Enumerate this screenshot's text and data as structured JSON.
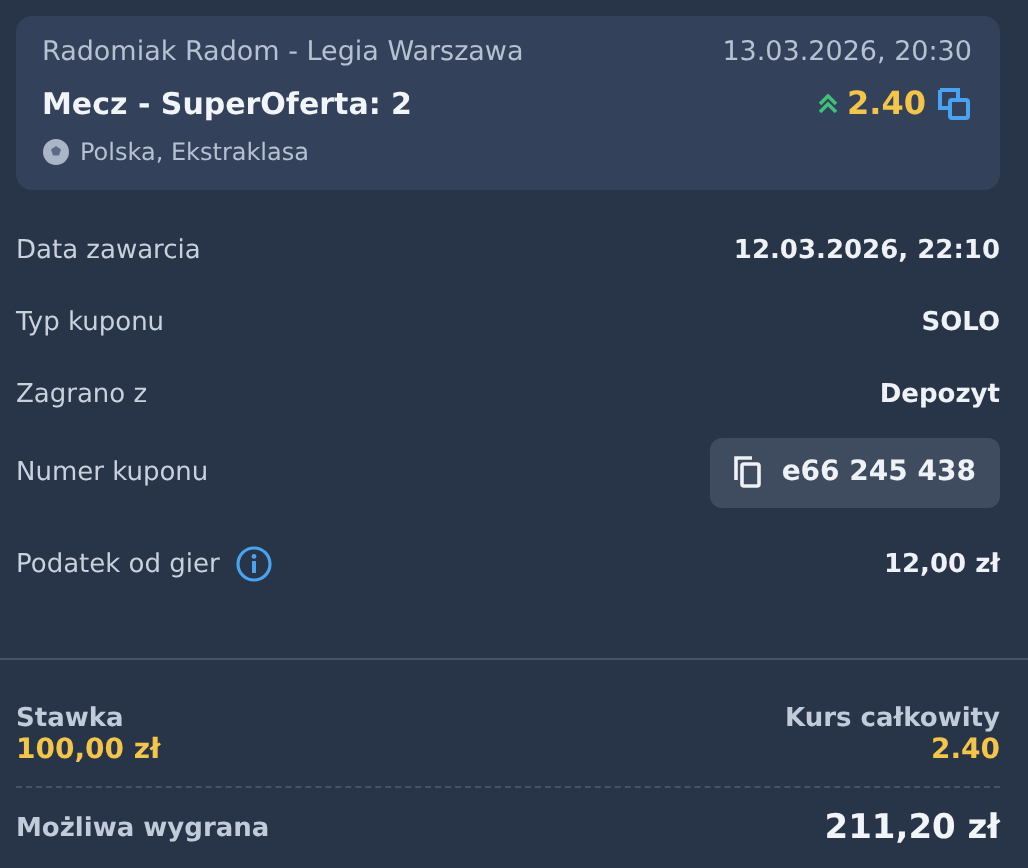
{
  "event": {
    "teams": "Radomiak Radom - Legia Warszawa",
    "datetime": "13.03.2026, 20:30",
    "market": "Mecz - SuperOferta: 2",
    "odds": "2.40",
    "odds_rising": true,
    "league": "Polska, Ekstraklasa"
  },
  "details": [
    {
      "kind": "plain",
      "label": "Data zawarcia",
      "value": "12.03.2026, 22:10"
    },
    {
      "kind": "plain",
      "label": "Typ kuponu",
      "value": "SOLO"
    },
    {
      "kind": "plain",
      "label": "Zagrano z",
      "value": "Depozyt"
    },
    {
      "kind": "copy",
      "label": "Numer kuponu",
      "value": "e66 245 438"
    },
    {
      "kind": "info",
      "label": "Podatek od gier",
      "value": "12,00 zł"
    }
  ],
  "summary": {
    "stake_label": "Stawka",
    "stake": "100,00 zł",
    "total_odds_label": "Kurs całkowity",
    "total_odds": "2.40",
    "win_label": "Możliwa wygrana",
    "win": "211,20 zł"
  }
}
